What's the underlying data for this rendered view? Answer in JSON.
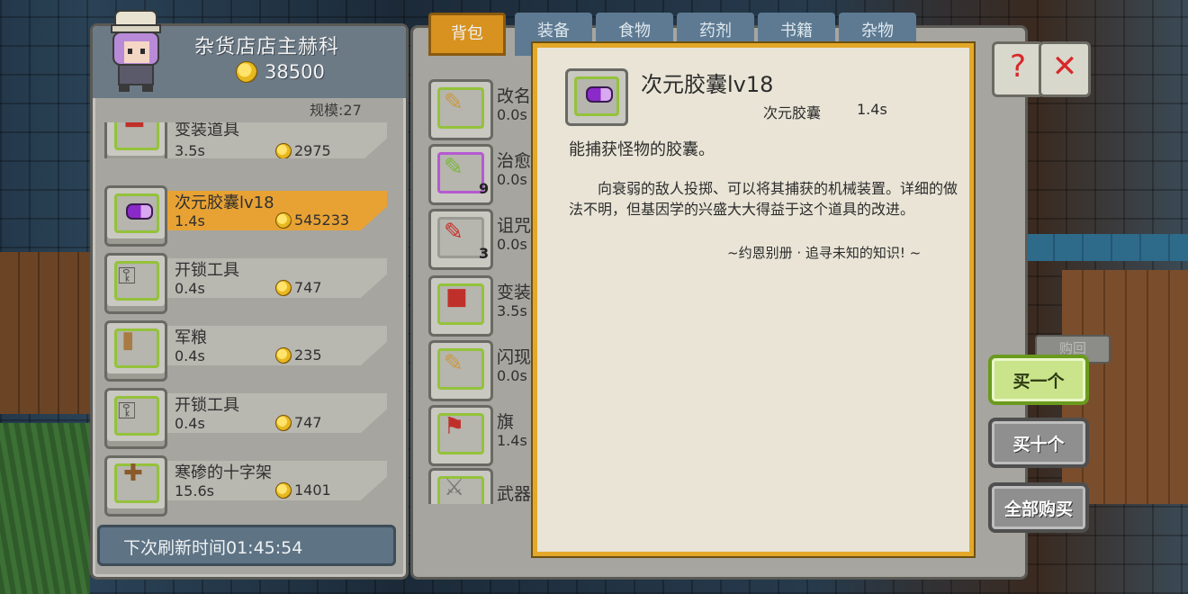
{
  "shop": {
    "owner_name": "杂货店店主赫科",
    "gold": "38500",
    "scale_label": "规模:27",
    "items": [
      {
        "name": "变装道具",
        "time": "3.5s",
        "price": "2975"
      },
      {
        "name": "次元胶囊lv18",
        "time": "1.4s",
        "price": "545233"
      },
      {
        "name": "开锁工具",
        "time": "0.4s",
        "price": "747"
      },
      {
        "name": "军粮",
        "time": "0.4s",
        "price": "235"
      },
      {
        "name": "开锁工具",
        "time": "0.4s",
        "price": "747"
      },
      {
        "name": "寒碜的十字架",
        "time": "15.6s",
        "price": "1401"
      }
    ],
    "refresh_text": "下次刷新时间01:45:54"
  },
  "bag": {
    "tabs": [
      "背包",
      "装备",
      "食物",
      "药剂",
      "书籍",
      "杂物"
    ],
    "items": [
      {
        "name": "改名",
        "time": "0.0s",
        "count": ""
      },
      {
        "name": "治愈",
        "time": "0.0s",
        "count": "9"
      },
      {
        "name": "诅咒",
        "time": "0.0s",
        "count": "3"
      },
      {
        "name": "变装",
        "time": "3.5s",
        "count": ""
      },
      {
        "name": "闪现",
        "time": "0.0s",
        "count": ""
      },
      {
        "name": "旗",
        "time": "1.4s",
        "count": ""
      },
      {
        "name": "武器",
        "time": "",
        "count": ""
      }
    ]
  },
  "detail": {
    "title": "次元胶囊lv18",
    "subtitle": "次元胶囊",
    "time": "1.4s",
    "summary": "能捕获怪物的胶囊。",
    "description": "向衰弱的敌人投掷、可以将其捕获的机械装置。详细的做法不明，但基因学的兴盛大大得益于这个道具的改进。",
    "quote": "~约恩别册 · 追寻未知的知识! ~"
  },
  "actions": {
    "buy_one": "买一个",
    "buy_ten": "买十个",
    "buy_all": "全部购买",
    "buyback": "购回"
  },
  "icons": {
    "coin": "coin-icon",
    "help": "question-icon",
    "close": "close-icon"
  }
}
